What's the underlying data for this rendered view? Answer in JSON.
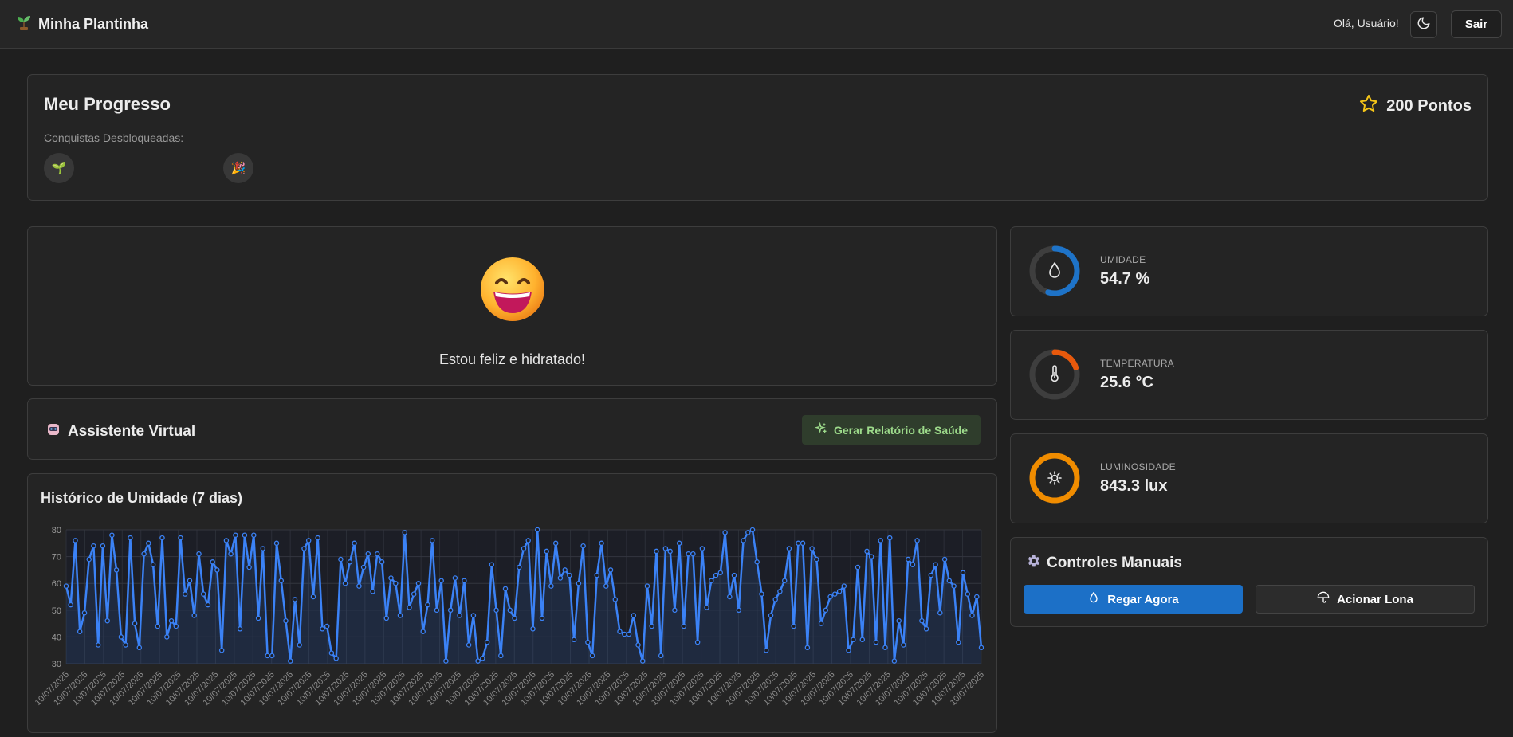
{
  "app": {
    "title": "Minha Plantinha",
    "greeting": "Olá, Usuário!",
    "logout_label": "Sair"
  },
  "progress": {
    "title": "Meu Progresso",
    "points_label": "200 Pontos",
    "achievements_label": "Conquistas Desbloqueadas:",
    "achievements": [
      "🌱",
      "🎉"
    ]
  },
  "mood": {
    "emoji": "grinning-face",
    "text": "Estou feliz e hidratado!"
  },
  "assistant": {
    "title": "Assistente Virtual",
    "report_button": "Gerar Relatório de Saúde"
  },
  "metrics": [
    {
      "label": "UMIDADE",
      "value": "54.7 %",
      "icon": "droplet-icon",
      "color": "#1e73c8",
      "fraction": 0.547
    },
    {
      "label": "TEMPERATURA",
      "value": "25.6 °C",
      "icon": "thermometer-icon",
      "color": "#e8590c",
      "fraction": 0.2
    },
    {
      "label": "LUMINOSIDADE",
      "value": "843.3 lux",
      "icon": "sun-icon",
      "color": "#f08c00",
      "fraction": 1.0
    }
  ],
  "controls": {
    "title": "Controles Manuais",
    "water_button": "Regar Agora",
    "cover_button": "Acionar Lona"
  },
  "colors": {
    "accent": "#3b82f6",
    "background": "#1f1f1f",
    "card": "#242424"
  },
  "chart_data": {
    "type": "line",
    "title": "Histórico de Umidade (7 dias)",
    "xlabel": "",
    "ylabel": "",
    "ylim": [
      30,
      80
    ],
    "yticks": [
      30,
      40,
      50,
      60,
      70,
      80
    ],
    "x_tick_label": "10/07/2025",
    "x_tick_count": 50,
    "grid": true,
    "series": [
      {
        "values": [
          59,
          52,
          76,
          42,
          49,
          69,
          74,
          37,
          74,
          46,
          78,
          65,
          40,
          37,
          77,
          45,
          36,
          71,
          75,
          67,
          44,
          77,
          40,
          46,
          44,
          77,
          56,
          61,
          48,
          71,
          56,
          52,
          68,
          65,
          35,
          76,
          71,
          78,
          43,
          78,
          66,
          78,
          47,
          73,
          33,
          33,
          75,
          61,
          46,
          31,
          54,
          37,
          73,
          76,
          55,
          77,
          43,
          44,
          34,
          32,
          69,
          60,
          68,
          75,
          59,
          66,
          71,
          57,
          71,
          68,
          47,
          62,
          60,
          48,
          79,
          51,
          56,
          60,
          42,
          52,
          76,
          50,
          61,
          31,
          50,
          62,
          48,
          61,
          37,
          48,
          31,
          32,
          38,
          67,
          50,
          33,
          58,
          50,
          47,
          66,
          73,
          76,
          43,
          80,
          47,
          72,
          59,
          75,
          62,
          65,
          63,
          39,
          60,
          74,
          38,
          33,
          63,
          75,
          59,
          65,
          54,
          42,
          41,
          41,
          48,
          37,
          31,
          59,
          44,
          72,
          33,
          73,
          72,
          50,
          75,
          44,
          71,
          71,
          38,
          73,
          51,
          61,
          63,
          64,
          79,
          55,
          63,
          50,
          76,
          79,
          80,
          68,
          56,
          35,
          48,
          54,
          57,
          61,
          73,
          44,
          75,
          75,
          36,
          73,
          69,
          45,
          50,
          55,
          56,
          57,
          59,
          35,
          39,
          66,
          39,
          72,
          70,
          38,
          76,
          36,
          77,
          31,
          46,
          37,
          69,
          67,
          76,
          46,
          43,
          63,
          67,
          49,
          69,
          61,
          59,
          38,
          64,
          56,
          48,
          55,
          36
        ]
      }
    ]
  }
}
